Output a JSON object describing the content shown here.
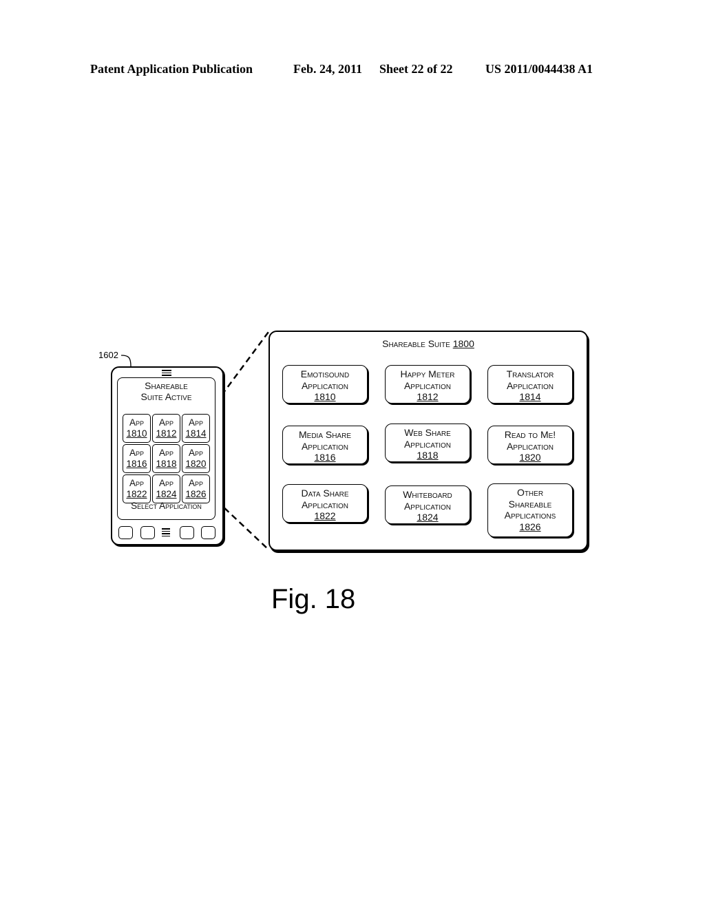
{
  "header": {
    "publication": "Patent Application Publication",
    "date": "Feb. 24, 2011",
    "sheet": "Sheet 22 of 22",
    "number": "US 2011/0044438 A1"
  },
  "device": {
    "ref": "1602",
    "screen_title_line1": "Shareable",
    "screen_title_line2": "Suite Active",
    "apps": [
      {
        "label": "App",
        "ref": "1810"
      },
      {
        "label": "App",
        "ref": "1812"
      },
      {
        "label": "App",
        "ref": "1814"
      },
      {
        "label": "App",
        "ref": "1816"
      },
      {
        "label": "App",
        "ref": "1818"
      },
      {
        "label": "App",
        "ref": "1820"
      },
      {
        "label": "App",
        "ref": "1822"
      },
      {
        "label": "App",
        "ref": "1824"
      },
      {
        "label": "App",
        "ref": "1826"
      }
    ],
    "select_label": "Select Application",
    "top_icon": "menu-icon",
    "bottom_icon": "menu-icon"
  },
  "suite": {
    "title": "Shareable Suite",
    "ref": "1800",
    "apps": [
      {
        "lines": [
          "Emotisound",
          "Application"
        ],
        "ref": "1810"
      },
      {
        "lines": [
          "Happy Meter",
          "Application"
        ],
        "ref": "1812"
      },
      {
        "lines": [
          "Translator",
          "Application"
        ],
        "ref": "1814"
      },
      {
        "lines": [
          "Media Share",
          "Application"
        ],
        "ref": "1816"
      },
      {
        "lines": [
          "Web Share",
          "Application"
        ],
        "ref": "1818"
      },
      {
        "lines": [
          "Read to Me!",
          "Application"
        ],
        "ref": "1820"
      },
      {
        "lines": [
          "Data Share",
          "Application"
        ],
        "ref": "1822"
      },
      {
        "lines": [
          "Whiteboard",
          "Application"
        ],
        "ref": "1824"
      },
      {
        "lines": [
          "Other",
          "Shareable",
          "Applications"
        ],
        "ref": "1826"
      }
    ]
  },
  "figure_label": "Fig. 18"
}
